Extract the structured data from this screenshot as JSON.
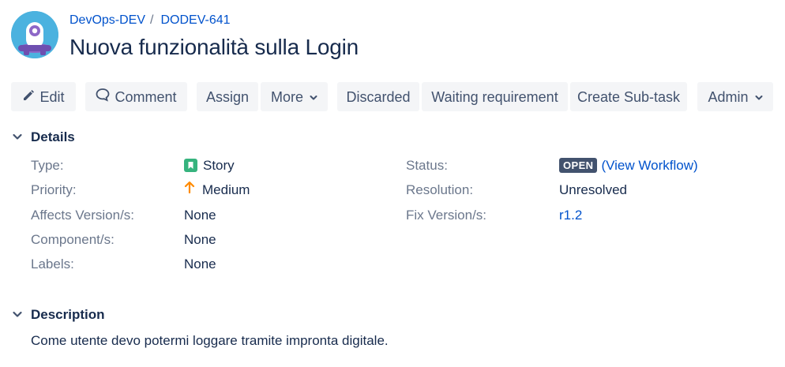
{
  "header": {
    "project_link": "DevOps-DEV",
    "separator": "/",
    "issue_key": "DODEV-641",
    "title": "Nuova funzionalità sulla Login"
  },
  "toolbar": {
    "edit": "Edit",
    "comment": "Comment",
    "assign": "Assign",
    "more": "More",
    "discarded": "Discarded",
    "waiting": "Waiting requirement",
    "create_subtask": "Create Sub-task",
    "admin": "Admin"
  },
  "details": {
    "heading": "Details",
    "type_label": "Type:",
    "type_value": "Story",
    "priority_label": "Priority:",
    "priority_value": "Medium",
    "affects_label": "Affects Version/s:",
    "affects_value": "None",
    "component_label": "Component/s:",
    "component_value": "None",
    "labels_label": "Labels:",
    "labels_value": "None",
    "status_label": "Status:",
    "status_value": "OPEN",
    "workflow_open": "(",
    "workflow_link": "View Workflow",
    "workflow_close": ")",
    "resolution_label": "Resolution:",
    "resolution_value": "Unresolved",
    "fix_label": "Fix Version/s:",
    "fix_value": "r1.2"
  },
  "description": {
    "heading": "Description",
    "text": "Come utente devo potermi loggare tramite impronta digitale."
  },
  "colors": {
    "link": "#0052cc",
    "text": "#172b4d",
    "label": "#6b778c",
    "button_bg": "#f4f5f7",
    "story_green": "#36b37e",
    "priority_orange": "#ff8b00",
    "lozenge": "#42526e"
  },
  "icons": {
    "avatar": "project-avatar-icon",
    "edit": "pencil-icon",
    "comment": "comment-bubble-icon",
    "dropdown": "chevron-down-icon",
    "section_toggle": "chevron-down-icon",
    "type": "story-icon",
    "priority": "arrow-up-icon"
  }
}
